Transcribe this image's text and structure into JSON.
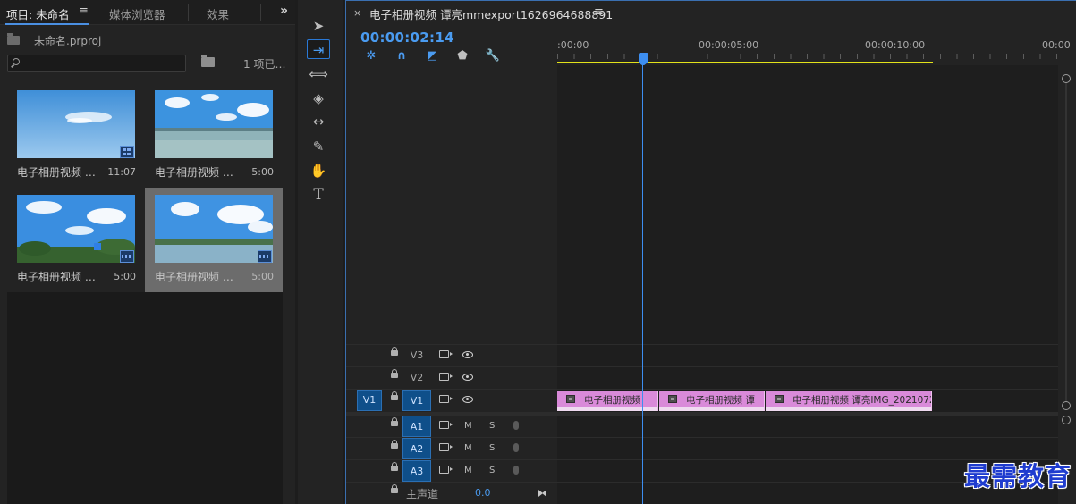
{
  "project_panel": {
    "tabs": [
      {
        "label": "项目: 未命名",
        "active": true
      },
      {
        "label": "媒体浏览器",
        "active": false
      },
      {
        "label": "效果",
        "active": false
      }
    ],
    "menu_glyph": "≡",
    "overflow_glyph": "»",
    "project_file": "未命名.prproj",
    "search_placeholder": "",
    "item_count": "1 项已…",
    "items": [
      {
        "name": "电子相册视频 …",
        "duration": "11:07",
        "badge": "sequence",
        "selected": false
      },
      {
        "name": "电子相册视频 …",
        "duration": "5:00",
        "badge": "none",
        "selected": false
      },
      {
        "name": "电子相册视频 …",
        "duration": "5:00",
        "badge": "video",
        "selected": false
      },
      {
        "name": "电子相册视频 …",
        "duration": "5:00",
        "badge": "video",
        "selected": true
      }
    ]
  },
  "tools": [
    {
      "name": "selection-tool",
      "glyph": "➤",
      "active": false
    },
    {
      "name": "track-select-forward-tool",
      "glyph": "⇥",
      "active": true
    },
    {
      "name": "ripple-edit-tool",
      "glyph": "⟺",
      "active": false
    },
    {
      "name": "razor-tool",
      "glyph": "◈",
      "active": false
    },
    {
      "name": "slip-tool",
      "glyph": "↔",
      "active": false
    },
    {
      "name": "pen-tool",
      "glyph": "✎",
      "active": false
    },
    {
      "name": "hand-tool",
      "glyph": "✋",
      "active": false
    },
    {
      "name": "type-tool",
      "glyph": "T",
      "active": false
    }
  ],
  "timeline": {
    "close_glyph": "×",
    "title": "电子相册视频 谭亮mmexport1626964688891",
    "menu_glyph": "≡",
    "timecode": "00:00:02:14",
    "ruler_labels": [
      ":00:00",
      "00:00:05:00",
      "00:00:10:00",
      "00:00"
    ],
    "video_tracks": [
      {
        "name": "V3",
        "targeted": false,
        "source_patch": ""
      },
      {
        "name": "V2",
        "targeted": false,
        "source_patch": ""
      },
      {
        "name": "V1",
        "targeted": true,
        "source_patch": "V1"
      }
    ],
    "audio_tracks": [
      {
        "name": "A1",
        "m": "M",
        "s": "S"
      },
      {
        "name": "A2",
        "m": "M",
        "s": "S"
      },
      {
        "name": "A3",
        "m": "M",
        "s": "S"
      }
    ],
    "clips": [
      {
        "name": "电子相册视频"
      },
      {
        "name": "电子相册视频 谭"
      },
      {
        "name": "电子相册视频 谭亮IMG_2021072"
      }
    ],
    "master": {
      "label": "主声道",
      "value": "0.0"
    }
  },
  "watermark": "最需教育",
  "colors": {
    "accent": "#4a9bf0",
    "clip": "#d98ad9",
    "workarea": "#e2e21a"
  }
}
